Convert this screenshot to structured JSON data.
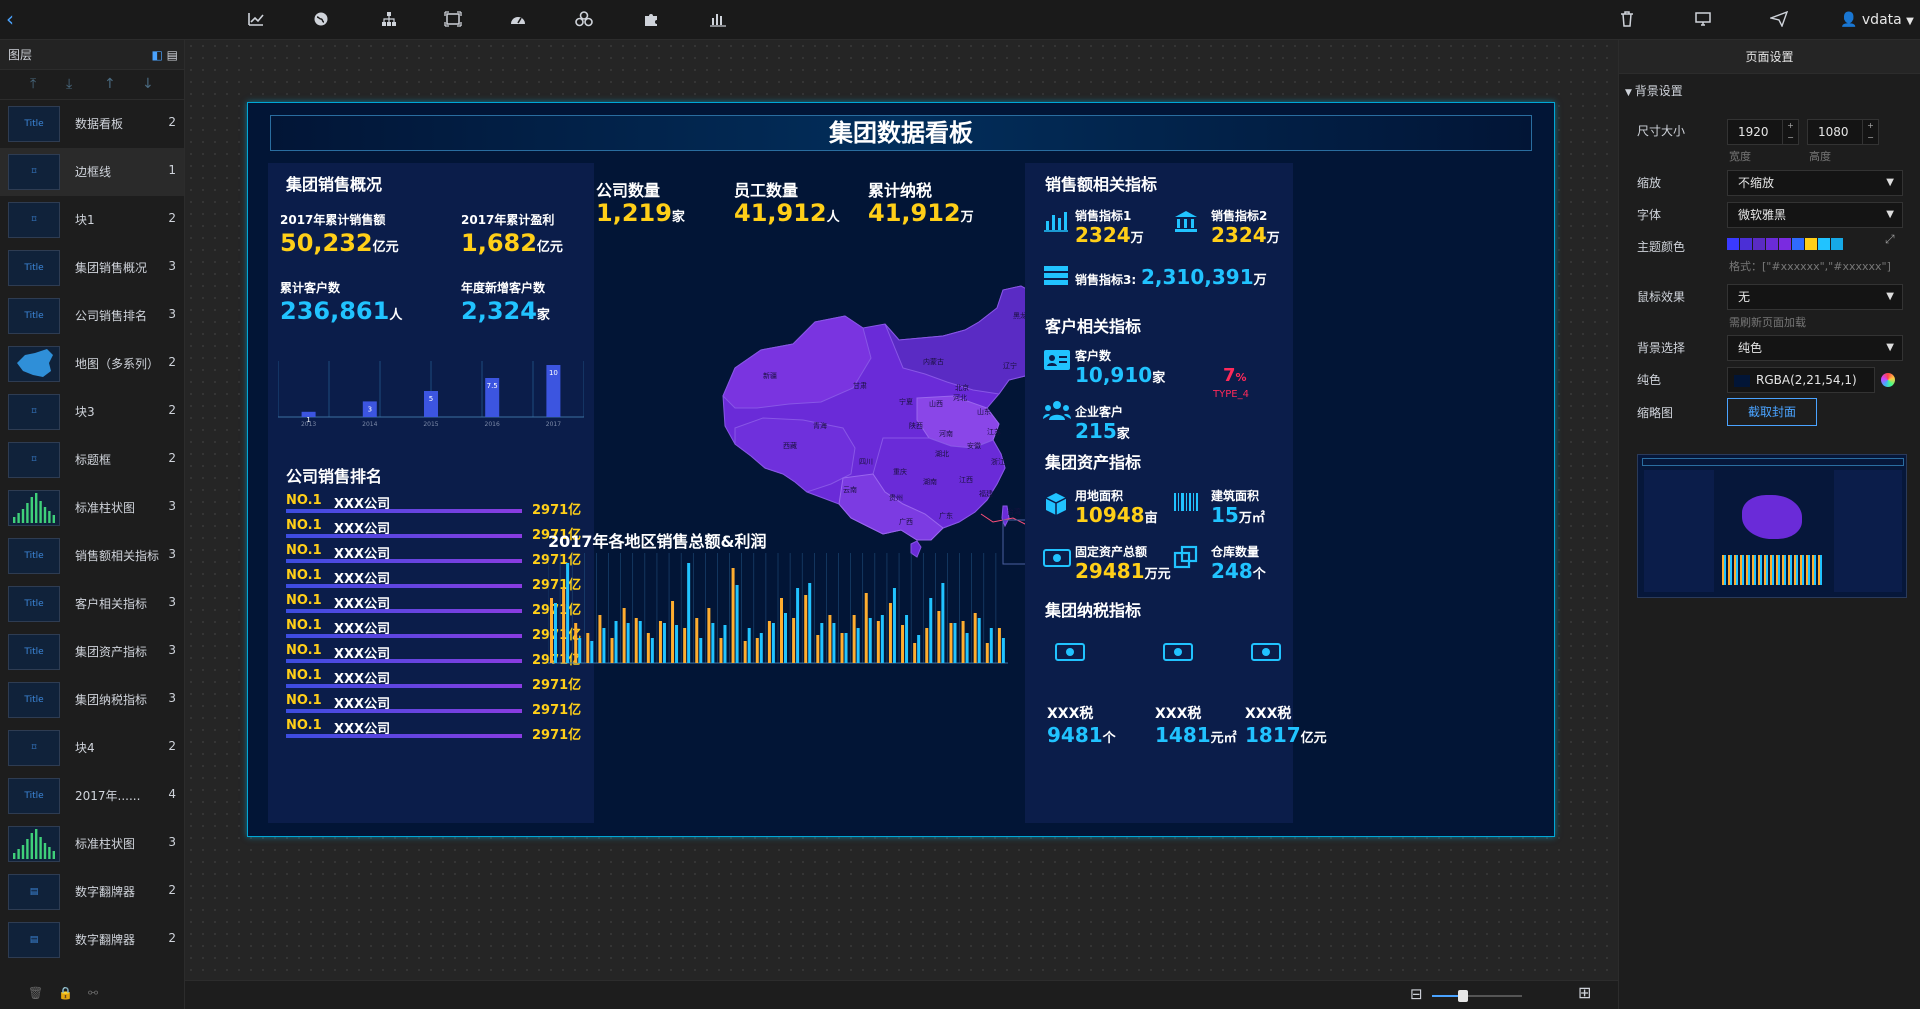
{
  "topbar": {
    "back_icon": "‹",
    "user": "vdata"
  },
  "layers": {
    "title": "图层",
    "items": [
      {
        "name": "数据看板",
        "count": "2",
        "thumb": "Title"
      },
      {
        "name": "边框线",
        "count": "1",
        "thumb": "⌑"
      },
      {
        "name": "块1",
        "count": "2",
        "thumb": "⌑"
      },
      {
        "name": "集团销售概况",
        "count": "3",
        "thumb": "Title"
      },
      {
        "name": "公司销售排名",
        "count": "3",
        "thumb": "Title"
      },
      {
        "name": "地图（多系列）",
        "count": "2",
        "thumb": "map"
      },
      {
        "name": "块3",
        "count": "2",
        "thumb": "⌑"
      },
      {
        "name": "标题框",
        "count": "2",
        "thumb": "⌑"
      },
      {
        "name": "标准柱状图",
        "count": "3",
        "thumb": "bars"
      },
      {
        "name": "销售额相关指标",
        "count": "3",
        "thumb": "Title"
      },
      {
        "name": "客户相关指标",
        "count": "3",
        "thumb": "Title"
      },
      {
        "name": "集团资产指标",
        "count": "3",
        "thumb": "Title"
      },
      {
        "name": "集团纳税指标",
        "count": "3",
        "thumb": "Title"
      },
      {
        "name": "块4",
        "count": "2",
        "thumb": "⌑"
      },
      {
        "name": "2017年......",
        "count": "4",
        "thumb": "Title"
      },
      {
        "name": "标准柱状图",
        "count": "3",
        "thumb": "bars"
      },
      {
        "name": "数字翻牌器",
        "count": "2",
        "thumb": "▤"
      },
      {
        "name": "数字翻牌器",
        "count": "2",
        "thumb": "▤"
      }
    ]
  },
  "props": {
    "title": "页面设置",
    "section": "背景设置",
    "size_label": "尺寸大小",
    "width": "1920",
    "height": "1080",
    "width_hint": "宽度",
    "height_hint": "高度",
    "zoom_label": "缩放",
    "zoom_value": "不缩放",
    "font_label": "字体",
    "font_value": "微软雅黑",
    "theme_label": "主题颜色",
    "theme_hint": "格式：[\"#xxxxxx\",\"#xxxxxx\"]",
    "theme_colors": [
      "#3a3aff",
      "#4b2fd6",
      "#5a2bc4",
      "#6a2bd8",
      "#7a2be0",
      "#2f6bff",
      "#ffcf18",
      "#21c3ff",
      "#16a9e6"
    ],
    "mouse_label": "鼠标效果",
    "mouse_value": "无",
    "mouse_hint": "需刷新页面加载",
    "bg_select_label": "背景选择",
    "bg_select_value": "纯色",
    "solid_label": "纯色",
    "solid_value": "RGBA(2,21,54,1)",
    "thumb_label": "缩略图",
    "thumb_button": "截取封面"
  },
  "dashboard": {
    "title": "集团数据看板",
    "sales_overview": {
      "title": "集团销售概况",
      "k1_label": "2017年累计销售额",
      "k1_value": "50,232",
      "k1_unit": "亿元",
      "k2_label": "2017年累计盈利",
      "k2_value": "1,682",
      "k2_unit": "亿元",
      "k3_label": "累计客户数",
      "k3_value": "236,861",
      "k3_unit": "人",
      "k4_label": "年度新增客户数",
      "k4_value": "2,324",
      "k4_unit": "家"
    },
    "mini_chart": {
      "type": "bar",
      "categories": [
        "2013",
        "2014",
        "2015",
        "2016",
        "2017"
      ],
      "values": [
        1,
        3,
        5,
        7.5,
        10
      ],
      "labels": [
        "1",
        "3",
        "5",
        "7.5",
        "10"
      ],
      "ylim": [
        0,
        10
      ]
    },
    "ranking": {
      "title": "公司销售排名",
      "rows": [
        {
          "no": "NO.1",
          "name": "XXX公司",
          "value": "2971亿"
        },
        {
          "no": "NO.1",
          "name": "XXX公司",
          "value": "2971亿"
        },
        {
          "no": "NO.1",
          "name": "XXX公司",
          "value": "2971亿"
        },
        {
          "no": "NO.1",
          "name": "XXX公司",
          "value": "2971亿"
        },
        {
          "no": "NO.1",
          "name": "XXX公司",
          "value": "2971亿"
        },
        {
          "no": "NO.1",
          "name": "XXX公司",
          "value": "2971亿"
        },
        {
          "no": "NO.1",
          "name": "XXX公司",
          "value": "2971亿"
        },
        {
          "no": "NO.1",
          "name": "XXX公司",
          "value": "2971亿"
        },
        {
          "no": "NO.1",
          "name": "XXX公司",
          "value": "2971亿"
        },
        {
          "no": "NO.1",
          "name": "XXX公司",
          "value": "2971亿"
        }
      ]
    },
    "center_kpis": [
      {
        "label": "公司数量",
        "value": "1,219",
        "unit": "家"
      },
      {
        "label": "员工数量",
        "value": "41,912",
        "unit": "人"
      },
      {
        "label": "累计纳税",
        "value": "41,912",
        "unit": "万"
      }
    ],
    "map": {
      "labels": [
        "新疆",
        "西藏",
        "青海",
        "甘肃",
        "内蒙古",
        "黑龙江",
        "吉林",
        "辽宁",
        "北京",
        "河北",
        "山西",
        "陕西",
        "宁夏",
        "四川",
        "重庆",
        "河南",
        "山东",
        "湖北",
        "安徽",
        "江苏",
        "湖南",
        "江西",
        "浙江",
        "贵州",
        "云南",
        "广西",
        "广东",
        "福建",
        "台湾"
      ]
    },
    "bar_chart": {
      "title": "2017年各地区销售总额&利润",
      "chart_data": {
        "type": "bar",
        "series": [
          {
            "color": "#ffad2f",
            "values": [
              65,
              75,
              40,
              30,
              48,
              25,
              55,
              45,
              30,
              42,
              62,
              35,
              45,
              55,
              25,
              95,
              22,
              25,
              42,
              65,
              45,
              68,
              28,
              48,
              30,
              48,
              70,
              42,
              60,
              38,
              20,
              35,
              52,
              40,
              42,
              50,
              20,
              35
            ]
          },
          {
            "color": "#21c3ff",
            "values": [
              60,
              100,
              25,
              22,
              35,
              42,
              40,
              42,
              25,
              40,
              38,
              100,
              25,
              40,
              38,
              78,
              35,
              30,
              40,
              50,
              75,
              80,
              40,
              40,
              30,
              35,
              45,
              48,
              75,
              48,
              28,
              65,
              80,
              40,
              30,
              45,
              35,
              25
            ]
          }
        ],
        "ylim": [
          0,
          110
        ]
      }
    },
    "sales_metrics": {
      "title": "销售额相关指标",
      "m1_label": "销售指标1",
      "m1_value": "2324",
      "m1_unit": "万",
      "m2_label": "销售指标2",
      "m2_value": "2324",
      "m2_unit": "万",
      "m3_label": "销售指标3:",
      "m3_value": "2,310,391",
      "m3_unit": "万"
    },
    "customer_metrics": {
      "title": "客户相关指标",
      "c1_label": "客户数",
      "c1_value": "10,910",
      "c1_unit": "家",
      "c2_label": "企业客户",
      "c2_value": "215",
      "c2_unit": "家",
      "gauge_value": "7",
      "gauge_unit": "%",
      "gauge_label": "TYPE_4"
    },
    "asset_metrics": {
      "title": "集团资产指标",
      "a1_label": "用地面积",
      "a1_value": "10948",
      "a1_unit": "亩",
      "a2_label": "建筑面积",
      "a2_value": "15",
      "a2_unit": "万㎡",
      "a3_label": "固定资产总额",
      "a3_value": "29481",
      "a3_unit": "万元",
      "a4_label": "仓库数量",
      "a4_value": "248",
      "a4_unit": "个"
    },
    "tax_metrics": {
      "title": "集团纳税指标",
      "t1_label": "XXX税",
      "t1_value": "9481",
      "t1_unit": "个",
      "t2_label": "XXX税",
      "t2_value": "1481",
      "t2_unit": "元㎡",
      "t3_label": "XXX税",
      "t3_value": "1817",
      "t3_unit": "亿元"
    }
  }
}
